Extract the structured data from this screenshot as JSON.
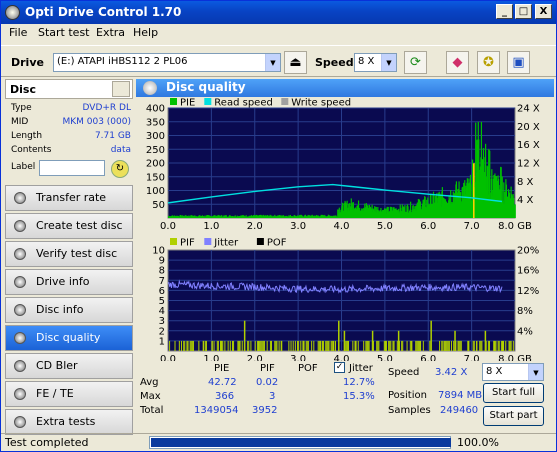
{
  "window": {
    "title": "Opti Drive Control 1.70",
    "min": "_",
    "max": "□",
    "close": "X"
  },
  "menu": [
    "File",
    "Start test",
    "Extra",
    "Help"
  ],
  "toolbar": {
    "drive_label": "Drive",
    "drive_value": "(E:)   ATAPI iHBS112   2 PL06",
    "speed_label": "Speed",
    "speed_value": "8 X",
    "icons": [
      "eject-icon",
      "refresh-icon",
      "eraser-icon",
      "media-icon",
      "save-icon"
    ]
  },
  "disc": {
    "header": "Disc",
    "fields": [
      {
        "key": "Type",
        "value": "DVD+R DL"
      },
      {
        "key": "MID",
        "value": "MKM 003 (000)"
      },
      {
        "key": "Length",
        "value": "7.71 GB"
      },
      {
        "key": "Contents",
        "value": "data"
      }
    ],
    "label_key": "Label"
  },
  "nav": [
    {
      "label": "Transfer rate",
      "active": false
    },
    {
      "label": "Create test disc",
      "active": false
    },
    {
      "label": "Verify test disc",
      "active": false
    },
    {
      "label": "Drive info",
      "active": false
    },
    {
      "label": "Disc info",
      "active": false
    },
    {
      "label": "Disc quality",
      "active": true
    },
    {
      "label": "CD Bler",
      "active": false
    },
    {
      "label": "FE / TE",
      "active": false
    },
    {
      "label": "Extra tests",
      "active": false
    }
  ],
  "main": {
    "title": "Disc quality"
  },
  "chart_data": [
    {
      "type": "bar",
      "legend": [
        "PIE",
        "Read speed",
        "Write speed"
      ],
      "colors": {
        "pie": "#00c000",
        "read": "#00e0e0",
        "write": "#a0a0a0",
        "bg": "#0a0a50",
        "grid": "#283c8c"
      },
      "xlim": [
        0,
        8.0
      ],
      "ylim": [
        0,
        400
      ],
      "x_ticks": [
        "0.0",
        "1.0",
        "2.0",
        "3.0",
        "4.0",
        "5.0",
        "6.0",
        "7.0",
        "8.0 GB"
      ],
      "y_ticks_left": [
        "50",
        "100",
        "150",
        "200",
        "250",
        "300",
        "350",
        "400"
      ],
      "y_ticks_right": [
        "4 X",
        "8 X",
        "12 X",
        "16 X",
        "20 X",
        "24 X"
      ],
      "pie_profile": [
        [
          0,
          8
        ],
        [
          3.9,
          9
        ],
        [
          3.9,
          35
        ],
        [
          4.2,
          55
        ],
        [
          4.5,
          45
        ],
        [
          5.0,
          30
        ],
        [
          5.5,
          40
        ],
        [
          6.0,
          65
        ],
        [
          6.5,
          95
        ],
        [
          7.0,
          120
        ],
        [
          7.1,
          280
        ],
        [
          7.3,
          170
        ],
        [
          7.6,
          120
        ],
        [
          7.9,
          100
        ],
        [
          8.0,
          60
        ]
      ],
      "read_speed": [
        [
          0,
          3.3
        ],
        [
          1,
          4.6
        ],
        [
          2,
          5.8
        ],
        [
          3,
          6.8
        ],
        [
          3.8,
          7.3
        ],
        [
          4.2,
          6.9
        ],
        [
          5,
          6.1
        ],
        [
          6,
          5.2
        ],
        [
          7,
          4.4
        ],
        [
          7.7,
          3.6
        ]
      ]
    },
    {
      "type": "bar",
      "legend": [
        "PIF",
        "Jitter",
        "POF"
      ],
      "colors": {
        "pif": "#b0d000",
        "jitter": "#8080ff",
        "pof": "#000000",
        "bg": "#0a0a50",
        "grid": "#283c8c"
      },
      "xlim": [
        0,
        8.0
      ],
      "ylim": [
        0,
        10
      ],
      "x_ticks": [
        "0.0",
        "1.0",
        "2.0",
        "3.0",
        "4.0",
        "5.0",
        "6.0",
        "7.0",
        "8.0 GB"
      ],
      "y_ticks_left": [
        "1",
        "2",
        "3",
        "4",
        "5",
        "6",
        "7",
        "8",
        "9",
        "10"
      ],
      "y_ticks_right": [
        "4%",
        "8%",
        "12%",
        "16%",
        "20%"
      ],
      "jitter_pct": [
        [
          0,
          13.2
        ],
        [
          1,
          12.9
        ],
        [
          2,
          12.7
        ],
        [
          3,
          12.3
        ],
        [
          4,
          12.2
        ],
        [
          5,
          12.4
        ],
        [
          6,
          12.6
        ],
        [
          7,
          12.6
        ],
        [
          7.7,
          12.4
        ]
      ]
    }
  ],
  "stats": {
    "headers": [
      "PIE",
      "PIF",
      "POF"
    ],
    "jitter_label": "Jitter",
    "rows": [
      {
        "label": "Avg",
        "pie": "42.72",
        "pif": "0.02",
        "pof": "",
        "jitter": "12.7%"
      },
      {
        "label": "Max",
        "pie": "366",
        "pif": "3",
        "pof": "",
        "jitter": "15.3%"
      },
      {
        "label": "Total",
        "pie": "1349054",
        "pif": "3952",
        "pof": "",
        "jitter": ""
      }
    ],
    "speed_label": "Speed",
    "speed_value": "3.42 X",
    "position_label": "Position",
    "position_value": "7894 MB",
    "samples_label": "Samples",
    "samples_value": "249460",
    "speed_select": "8 X",
    "start_full": "Start full",
    "start_part": "Start part"
  },
  "status": {
    "text": "Test completed",
    "progress": 1.0,
    "progress_label": "100.0%"
  }
}
